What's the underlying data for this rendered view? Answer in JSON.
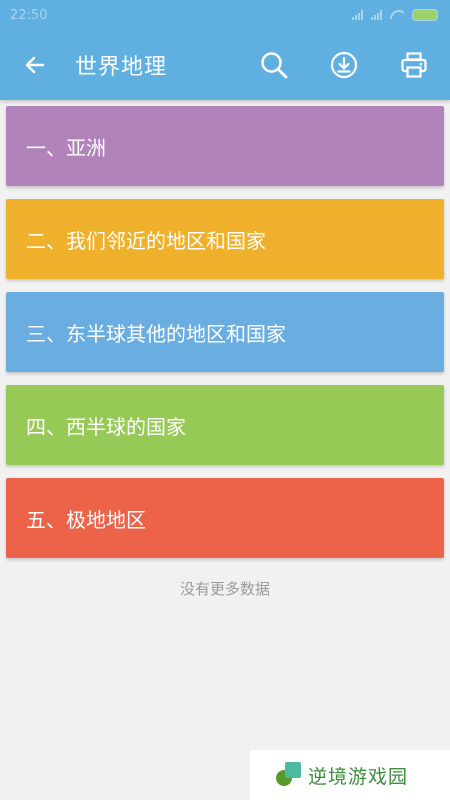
{
  "status_bar": {
    "time": "22:50"
  },
  "app_bar": {
    "title": "世界地理",
    "back_icon": "arrow-left-icon",
    "actions": [
      "search-icon",
      "download-icon",
      "print-icon"
    ]
  },
  "colors": {
    "app_bar": "#5fb0e1",
    "card_1": "#b283bb",
    "card_2": "#efb02b",
    "card_3": "#6aaee1",
    "card_4": "#97c956",
    "card_5": "#ed6349"
  },
  "list": {
    "items": [
      {
        "label": "一、亚洲",
        "color": "#b283bb"
      },
      {
        "label": "二、我们邻近的地区和国家",
        "color": "#efb02b"
      },
      {
        "label": "三、东半球其他的地区和国家",
        "color": "#6aaee1"
      },
      {
        "label": "四、西半球的国家",
        "color": "#97c956"
      },
      {
        "label": "五、极地地区",
        "color": "#ed6349"
      }
    ],
    "end_note": "没有更多数据"
  },
  "watermark": {
    "text": "逆境游戏园"
  }
}
